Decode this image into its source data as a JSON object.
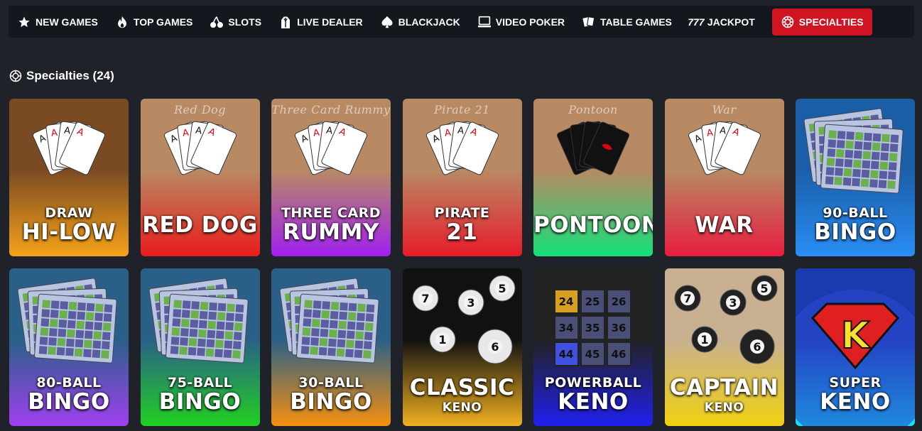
{
  "nav": [
    {
      "label": "NEW GAMES",
      "icon": "star-icon"
    },
    {
      "label": "TOP GAMES",
      "icon": "flame-icon"
    },
    {
      "label": "SLOTS",
      "icon": "cherries-icon"
    },
    {
      "label": "LIVE DEALER",
      "icon": "dealer-icon"
    },
    {
      "label": "BLACKJACK",
      "icon": "spade-icon"
    },
    {
      "label": "VIDEO POKER",
      "icon": "monitor-icon"
    },
    {
      "label": "TABLE GAMES",
      "icon": "cards-icon"
    },
    {
      "label": "JACKPOT",
      "icon": "777-icon"
    },
    {
      "label": "SPECIALTIES",
      "icon": "chip-icon",
      "active": true
    }
  ],
  "section": {
    "title": "Specialties (24)"
  },
  "colors": {
    "nav_bg": "#14171d",
    "active": "#d01421",
    "page_bg": "#1f2229"
  },
  "tiles": [
    {
      "l1": "DRAW",
      "l2": "HI-LOW",
      "banner": "",
      "grad": [
        "#7a4a22",
        "#f6a21a"
      ]
    },
    {
      "l1": "",
      "l2": "RED DOG",
      "banner": "Red Dog",
      "grad": [
        "#b88a63",
        "#e81c1c"
      ]
    },
    {
      "l1": "THREE CARD",
      "l2": "RUMMY",
      "banner": "Three Card Rummy",
      "grad": [
        "#b88a63",
        "#a020f0"
      ]
    },
    {
      "l1": "PIRATE",
      "l2": "21",
      "banner": "Pirate 21",
      "grad": [
        "#b88a63",
        "#e81c2a"
      ]
    },
    {
      "l1": "",
      "l2": "PONTOON",
      "banner": "Pontoon",
      "grad": [
        "#b88a63",
        "#14e07a"
      ]
    },
    {
      "l1": "",
      "l2": "WAR",
      "banner": "War",
      "grad": [
        "#b88a63",
        "#e81c40"
      ]
    },
    {
      "l1": "90-BALL",
      "l2": "BINGO",
      "banner": "",
      "grad": [
        "#1a5ea8",
        "#2a8ef5"
      ]
    },
    {
      "l1": "80-BALL",
      "l2": "BINGO",
      "banner": "",
      "grad": [
        "#2a6088",
        "#a040f0"
      ]
    },
    {
      "l1": "75-BALL",
      "l2": "BINGO",
      "banner": "",
      "grad": [
        "#2a6088",
        "#22d022"
      ]
    },
    {
      "l1": "30-BALL",
      "l2": "BINGO",
      "banner": "",
      "grad": [
        "#2a6088",
        "#f59010"
      ]
    },
    {
      "l1": "",
      "l2": "CLASSIC",
      "sub": "KENO",
      "banner": "",
      "grad": [
        "#111111",
        "#f0b020"
      ]
    },
    {
      "l1": "POWERBALL",
      "l2": "KENO",
      "banner": "",
      "grad": [
        "#222222",
        "#2020f0"
      ],
      "balls": [
        "24",
        "25",
        "26",
        "34",
        "35",
        "36",
        "44",
        "45",
        "46"
      ]
    },
    {
      "l1": "",
      "l2": "CAPTAIN",
      "sub": "KENO",
      "banner": "",
      "grad": [
        "#c8b090",
        "#f0d010"
      ]
    },
    {
      "l1": "SUPER",
      "l2": "KENO",
      "banner": "",
      "grad": [
        "#1a3ab0",
        "#10e8f0"
      ],
      "logo": "K"
    }
  ]
}
